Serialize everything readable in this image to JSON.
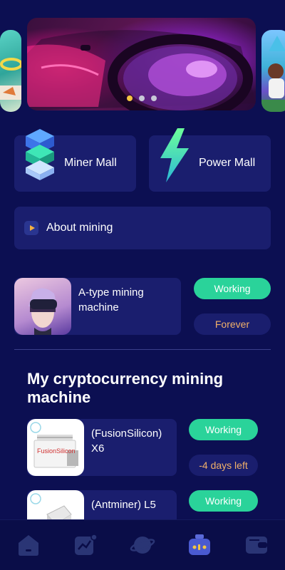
{
  "banner": {
    "slide_count": 3,
    "active_slide": 0
  },
  "malls": [
    {
      "label": "Miner Mall",
      "icon": "cube-stack-icon"
    },
    {
      "label": "Power Mall",
      "icon": "lightning-icon"
    }
  ],
  "about": {
    "label": "About mining",
    "icon": "play-icon"
  },
  "featured_machine": {
    "name": "A-type mining machine",
    "status": "Working",
    "duration": "Forever"
  },
  "my_machines": {
    "title": "My cryptocurrency mining machine",
    "items": [
      {
        "name": "(FusionSilicon) X6",
        "status": "Working",
        "time_left": "-4 days left",
        "brand": "FusionSilicon"
      },
      {
        "name": "(Antminer) L5",
        "status": "Working"
      }
    ]
  },
  "bottom_nav": {
    "items": [
      {
        "icon": "home-icon"
      },
      {
        "icon": "chart-icon"
      },
      {
        "icon": "planet-icon"
      },
      {
        "icon": "miner-icon",
        "active": true
      },
      {
        "icon": "wallet-icon"
      }
    ]
  },
  "colors": {
    "background": "#0c0f52",
    "card": "#1a1e6e",
    "green": "#2ad39a",
    "orange_text": "#f0b06a",
    "active_dot": "#f5c542"
  }
}
